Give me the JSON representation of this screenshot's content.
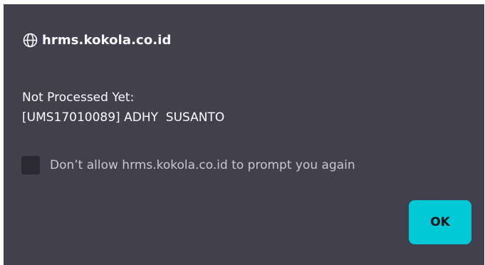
{
  "dialog": {
    "domain": "hrms.kokola.co.id",
    "message_line1": "Not Processed Yet:",
    "message_line2": "[UMS17010089] ADHY  SUSANTO",
    "checkbox_label": "Don’t allow hrms.kokola.co.id to prompt you again",
    "checkbox_checked": false,
    "ok_label": "OK"
  },
  "icons": {
    "domain_icon": "globe-icon"
  },
  "colors": {
    "dialog_background": "#43404d",
    "text": "#fbfbfe",
    "checkbox_background": "#2b2a33",
    "button_accent": "#00c8d7",
    "button_text": "#15141a"
  }
}
